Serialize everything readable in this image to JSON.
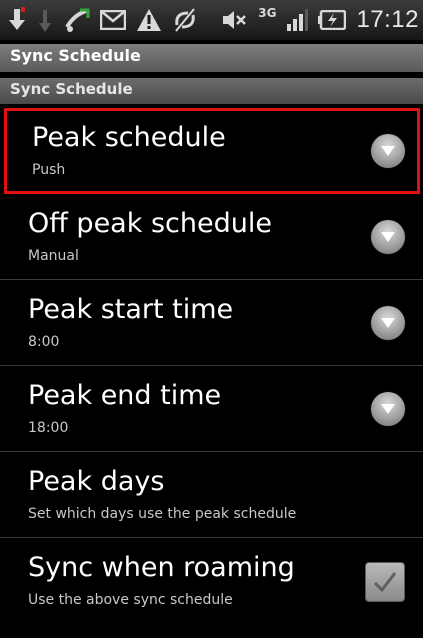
{
  "statusbar": {
    "icons": [
      "download-icon",
      "usb-icon",
      "missed-call-icon",
      "email-icon",
      "warning-icon",
      "sync-icon",
      "mute-icon",
      "3g-icon",
      "signal-icon",
      "battery-icon"
    ],
    "network": "3G",
    "time": "17:12"
  },
  "titlebar": {
    "title": "Sync Schedule"
  },
  "section": {
    "label": "Sync Schedule"
  },
  "items": [
    {
      "primary": "Peak schedule",
      "secondary": "Push",
      "control": "dropdown",
      "highlighted": true
    },
    {
      "primary": "Off peak schedule",
      "secondary": "Manual",
      "control": "dropdown"
    },
    {
      "primary": "Peak start time",
      "secondary": "8:00",
      "control": "dropdown"
    },
    {
      "primary": "Peak end time",
      "secondary": "18:00",
      "control": "dropdown"
    },
    {
      "primary": "Peak days",
      "secondary": "Set which days use the peak schedule",
      "control": "none"
    },
    {
      "primary": "Sync when roaming",
      "secondary": "Use the above sync schedule",
      "control": "checkbox",
      "checked": true
    }
  ],
  "colors": {
    "highlight": "#e01010",
    "background": "#000000"
  }
}
